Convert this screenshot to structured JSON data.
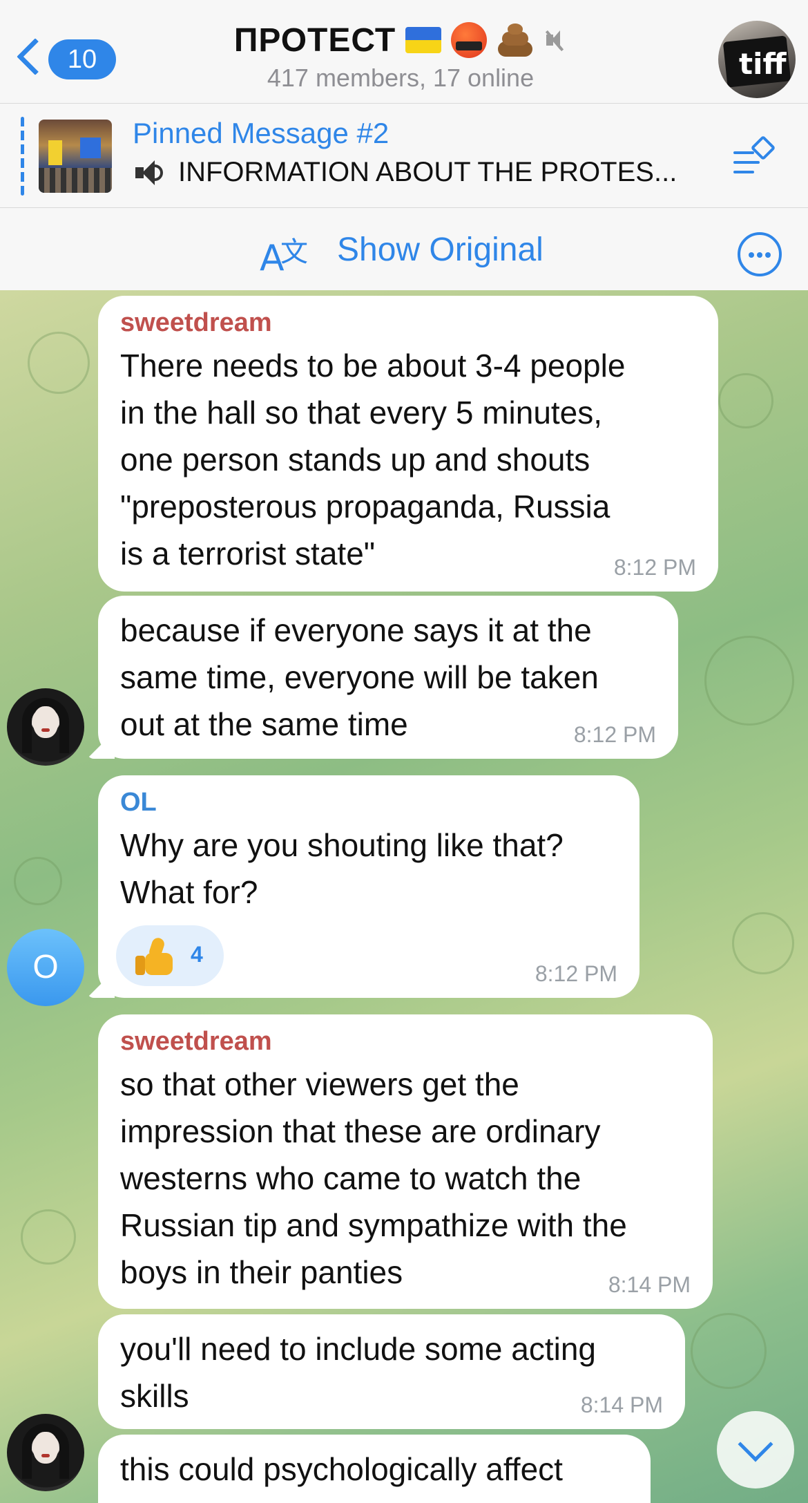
{
  "header": {
    "back_count": "10",
    "title": "ПРОТЕСТ",
    "subtitle": "417 members, 17 online",
    "face_emoji_text": "&$!#%"
  },
  "pinned": {
    "title": "Pinned Message #2",
    "text": "INFORMATION ABOUT THE PROTES..."
  },
  "translate": {
    "label": "Show Original"
  },
  "messages": [
    {
      "sender": "sweetdream",
      "sender_color": "#c0504d",
      "lines": [
        "There needs to be about 3-4 people",
        "in the hall so that every 5 minutes,",
        "one person stands up and shouts",
        "\"preposterous propaganda, Russia",
        "is a terrorist state\""
      ],
      "time": "8:12 PM"
    },
    {
      "lines": [
        "because if everyone says it at the",
        "same time, everyone will be taken",
        "out at the same time"
      ],
      "time": "8:12 PM"
    },
    {
      "sender": "OL",
      "sender_color": "#3a88d6",
      "lines": [
        "Why are you shouting like that?",
        "What for?"
      ],
      "time": "8:12 PM",
      "reaction": {
        "icon": "thumbs-up",
        "count": "4"
      }
    },
    {
      "sender": "sweetdream",
      "sender_color": "#c0504d",
      "lines": [
        "so that other viewers get the",
        "impression that these are ordinary",
        "westerns who came to watch the",
        "Russian tip and sympathize with the",
        "boys in their panties"
      ],
      "time": "8:14 PM"
    },
    {
      "lines": [
        "you'll need to include some acting",
        "skills"
      ],
      "time": "8:14 PM"
    },
    {
      "lines": [
        "this could psychologically affect"
      ]
    }
  ],
  "avatars": {
    "ol_letter": "O"
  },
  "colors": {
    "accent": "#2f86e8",
    "bubble": "#ffffff"
  }
}
